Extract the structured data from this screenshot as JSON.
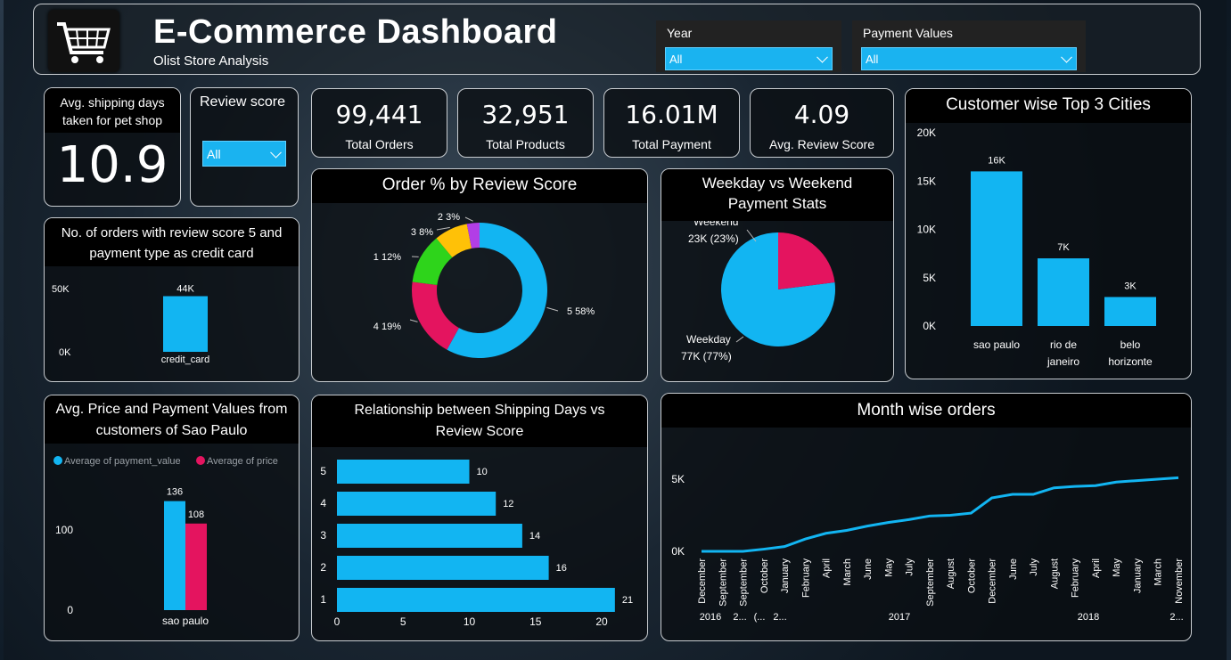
{
  "header": {
    "title": "E-Commerce Dashboard",
    "subtitle": "Olist Store Analysis",
    "year_label": "Year",
    "year_value": "All",
    "payment_label": "Payment Values",
    "payment_value": "All",
    "logo_icon": "shopping-cart-icon"
  },
  "shipping_kpi": {
    "label": "Avg. shipping days taken for pet shop",
    "value": "10.9"
  },
  "review_slicer": {
    "label": "Review score",
    "value": "All"
  },
  "kpis": [
    {
      "value": "99,441",
      "label": "Total Orders"
    },
    {
      "value": "32,951",
      "label": "Total Products"
    },
    {
      "value": "16.01M",
      "label": "Total Payment"
    },
    {
      "value": "4.09",
      "label": "Avg. Review Score"
    }
  ],
  "colors": {
    "blue": "#12b5f2",
    "pink": "#e4145f",
    "green": "#2ed41b",
    "yellow": "#ffc107",
    "purple": "#b23ee6"
  },
  "chart_data": [
    {
      "id": "credit_card",
      "type": "bar",
      "title": "No. of orders with review score 5 and payment type as credit card",
      "categories": [
        "credit_card"
      ],
      "values": [
        44
      ],
      "data_labels": [
        "44K"
      ],
      "ticks": [
        "50K",
        "0K"
      ],
      "ylim": [
        0,
        50
      ]
    },
    {
      "id": "review_donut",
      "type": "pie",
      "title": "Order % by Review Score",
      "categories": [
        "5",
        "4",
        "1",
        "3",
        "2"
      ],
      "values": [
        58,
        19,
        12,
        8,
        3
      ],
      "labels": [
        "5 58%",
        "4 19%",
        "1 12%",
        "3 8%",
        "2 3%"
      ]
    },
    {
      "id": "weekday_pie",
      "type": "pie",
      "title": "Weekday vs Weekend Payment Stats",
      "categories": [
        "Weekday",
        "Weekend"
      ],
      "values": [
        77,
        23
      ],
      "labels": [
        {
          "name": "Weekday",
          "value": "77K (77%)"
        },
        {
          "name": "Weekend",
          "value": "23K (23%)"
        }
      ]
    },
    {
      "id": "top_cities",
      "type": "bar",
      "title": "Customer wise Top 3 Cities",
      "categories": [
        [
          "sao paulo"
        ],
        [
          "rio de",
          "janeiro"
        ],
        [
          "belo",
          "horizonte"
        ]
      ],
      "values": [
        16,
        7,
        3
      ],
      "data_labels": [
        "16K",
        "7K",
        "3K"
      ],
      "ticks": [
        "20K",
        "15K",
        "10K",
        "5K",
        "0K"
      ],
      "ylim": [
        0,
        20
      ]
    },
    {
      "id": "sao_paulo_price",
      "type": "bar",
      "title": "Avg. Price and Payment Values from customers of Sao Paulo",
      "categories": [
        "sao paulo"
      ],
      "series": [
        {
          "name": "Average of payment_value",
          "values": [
            136
          ]
        },
        {
          "name": "Average of price",
          "values": [
            108
          ]
        }
      ],
      "data_labels": [
        "136",
        "108"
      ],
      "ticks": [
        "100",
        "0"
      ],
      "ylim": [
        0,
        150
      ]
    },
    {
      "id": "shipping_vs_review",
      "type": "bar",
      "title": "Relationship between Shipping Days vs Review Score",
      "categories": [
        "5",
        "4",
        "3",
        "2",
        "1"
      ],
      "values": [
        10,
        12,
        14,
        16,
        21
      ],
      "xticks": [
        "0",
        "5",
        "10",
        "15",
        "20"
      ],
      "xlim": [
        0,
        22
      ]
    },
    {
      "id": "month_orders",
      "type": "line",
      "title": "Month wise orders",
      "x": [
        "December",
        "September",
        "September",
        "October",
        "January",
        "February",
        "April",
        "March",
        "June",
        "May",
        "July",
        "September",
        "August",
        "October",
        "December",
        "June",
        "July",
        "August",
        "February",
        "April",
        "May",
        "January",
        "March",
        "November"
      ],
      "values": [
        0,
        0,
        0,
        150,
        330,
        850,
        1250,
        1450,
        1750,
        2000,
        2200,
        2450,
        2500,
        2650,
        3700,
        3950,
        3950,
        4400,
        4500,
        4550,
        4800,
        4900,
        5000,
        5100
      ],
      "year_labels": [
        "2016",
        "2...",
        "(...",
        "2...",
        "2017",
        "2018",
        "2..."
      ],
      "ticks": [
        "5K",
        "0K"
      ],
      "ylim": [
        0,
        7000
      ]
    }
  ]
}
